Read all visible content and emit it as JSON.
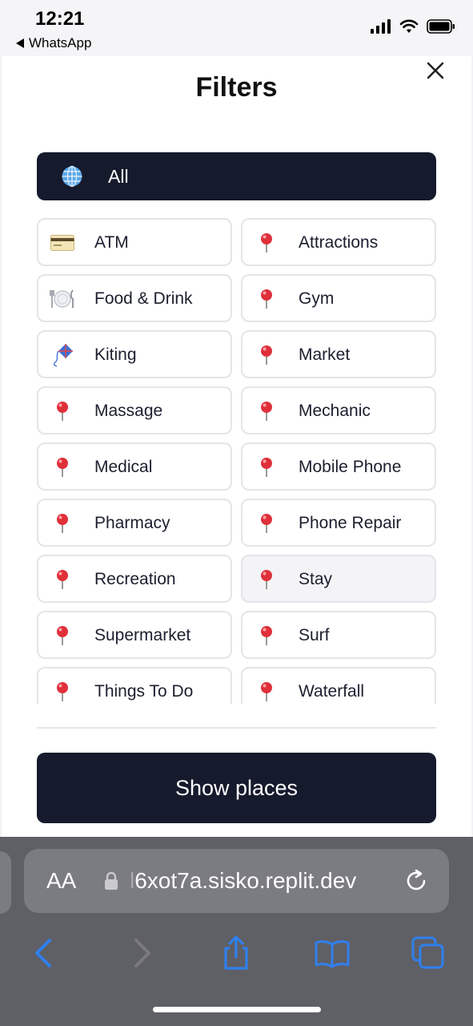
{
  "status_bar": {
    "time": "12:21",
    "back_app": "WhatsApp",
    "icons": [
      "signal-icon",
      "wifi-icon",
      "battery-icon"
    ]
  },
  "modal": {
    "title": "Filters",
    "close_icon": "close-icon",
    "all": {
      "label": "All",
      "icon": "globe-icon"
    },
    "filters": [
      {
        "label": "ATM",
        "icon": "credit-card-icon"
      },
      {
        "label": "Attractions",
        "icon": "pin-icon"
      },
      {
        "label": "Food & Drink",
        "icon": "plate-icon"
      },
      {
        "label": "Gym",
        "icon": "pin-icon"
      },
      {
        "label": "Kiting",
        "icon": "kite-icon"
      },
      {
        "label": "Market",
        "icon": "pin-icon"
      },
      {
        "label": "Massage",
        "icon": "pin-icon"
      },
      {
        "label": "Mechanic",
        "icon": "pin-icon"
      },
      {
        "label": "Medical",
        "icon": "pin-icon"
      },
      {
        "label": "Mobile Phone",
        "icon": "pin-icon"
      },
      {
        "label": "Pharmacy",
        "icon": "pin-icon"
      },
      {
        "label": "Phone Repair",
        "icon": "pin-icon"
      },
      {
        "label": "Recreation",
        "icon": "pin-icon"
      },
      {
        "label": "Stay",
        "icon": "pin-icon",
        "highlighted": true
      },
      {
        "label": "Supermarket",
        "icon": "pin-icon"
      },
      {
        "label": "Surf",
        "icon": "pin-icon"
      },
      {
        "label": "Things To Do",
        "icon": "pin-icon"
      },
      {
        "label": "Waterfall",
        "icon": "pin-icon"
      }
    ],
    "show_button": "Show places"
  },
  "browser": {
    "aa_label": "AA",
    "url_faded": "l",
    "url": "6xot7a.sisko.replit.dev",
    "toolbar": [
      "back-icon",
      "forward-icon",
      "share-icon",
      "bookmarks-icon",
      "tabs-icon"
    ]
  },
  "colors": {
    "dark": "#151a2c",
    "pin": "#e0303a",
    "safari_blue": "#2f80ed",
    "browser_bg": "#5f5f66"
  }
}
